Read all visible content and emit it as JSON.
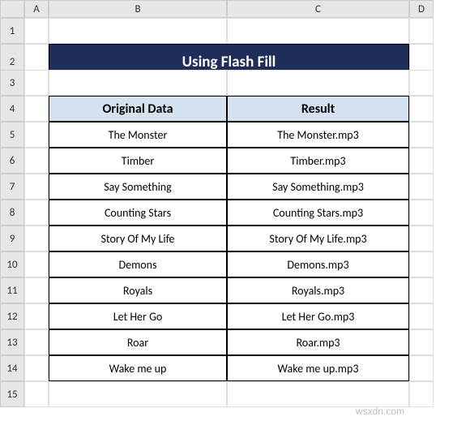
{
  "columns": [
    "A",
    "B",
    "C",
    "D"
  ],
  "rows": [
    "1",
    "2",
    "3",
    "4",
    "5",
    "6",
    "7",
    "8",
    "9",
    "10",
    "11",
    "12",
    "13",
    "14",
    "15"
  ],
  "title": "Using Flash Fill",
  "headers": {
    "original": "Original Data",
    "result": "Result"
  },
  "data": [
    {
      "original": "The Monster",
      "result": "The Monster.mp3"
    },
    {
      "original": "Timber",
      "result": "Timber.mp3"
    },
    {
      "original": "Say Something",
      "result": "Say Something.mp3"
    },
    {
      "original": "Counting Stars",
      "result": "Counting Stars.mp3"
    },
    {
      "original": "Story Of My Life",
      "result": "Story Of My Life.mp3"
    },
    {
      "original": "Demons",
      "result": "Demons.mp3"
    },
    {
      "original": "Royals",
      "result": "Royals.mp3"
    },
    {
      "original": "Let Her Go",
      "result": "Let Her Go.mp3"
    },
    {
      "original": "Roar",
      "result": "Roar.mp3"
    },
    {
      "original": "Wake me up",
      "result": "Wake me up.mp3"
    }
  ],
  "watermark": "wsxdn.com"
}
